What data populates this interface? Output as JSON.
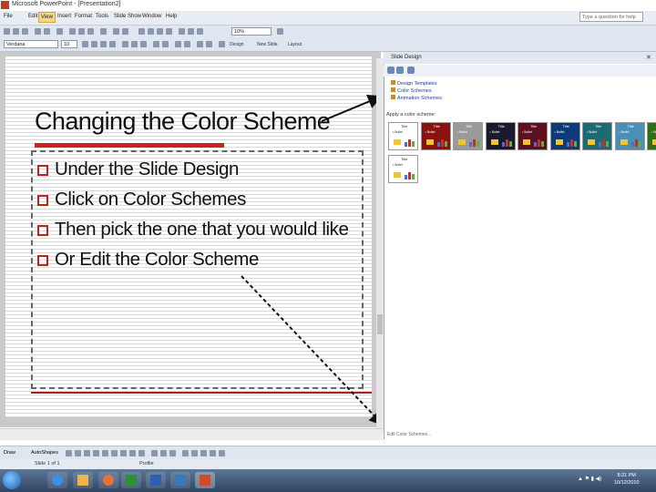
{
  "window": {
    "title": "Microsoft PowerPoint - [Presentation2]"
  },
  "menu": [
    "File",
    "Edit",
    "View",
    "Insert",
    "Format",
    "Tools",
    "Slide Show",
    "Window",
    "Help"
  ],
  "menu_selected": "View",
  "help_search_placeholder": "Type a question for help",
  "formatting": {
    "font": "Verdana",
    "size": "10",
    "zoom": "10%"
  },
  "toolbar_buttons": [
    "Design",
    "New Slide",
    "Layout"
  ],
  "slide": {
    "title": "Changing the Color Scheme",
    "bullets": [
      "Under the Slide Design",
      "Click on Color Schemes",
      "Then pick the one that you would like",
      "Or Edit the Color Scheme"
    ]
  },
  "task_pane": {
    "title": "Slide Design",
    "links": [
      "Design Templates",
      "Color Schemes",
      "Animation Schemes"
    ],
    "apply_label": "Apply a color scheme:",
    "scheme_title": "Title",
    "scheme_bullet": "• Bullet",
    "schemes": [
      {
        "bg": "#ffffff",
        "title": "#333333"
      },
      {
        "bg": "#8b1010",
        "title": "#ffffff"
      },
      {
        "bg": "#9a9a9a",
        "title": "#ffffff"
      },
      {
        "bg": "#1a1a2e",
        "title": "#ffffff"
      },
      {
        "bg": "#5c1020",
        "title": "#ffffff"
      },
      {
        "bg": "#0d3b7a",
        "title": "#ffffff"
      },
      {
        "bg": "#1e6a72",
        "title": "#ffffff"
      },
      {
        "bg": "#4a8fb5",
        "title": "#ffffff"
      },
      {
        "bg": "#2f6e16",
        "title": "#ffffff"
      },
      {
        "bg": "#ffffff",
        "title": "#333333"
      }
    ],
    "footer_link": "Edit Color Schemes..."
  },
  "draw_toolbar": {
    "draw": "Draw",
    "autoshapes": "AutoShapes"
  },
  "status": {
    "slide": "Slide 1 of 1",
    "design": "Profile"
  },
  "clock": {
    "time": "8:21 PM",
    "date": "10/12/2010"
  },
  "colors": {
    "accent_red": "#d0221c",
    "taskbar": "#3a5270"
  }
}
